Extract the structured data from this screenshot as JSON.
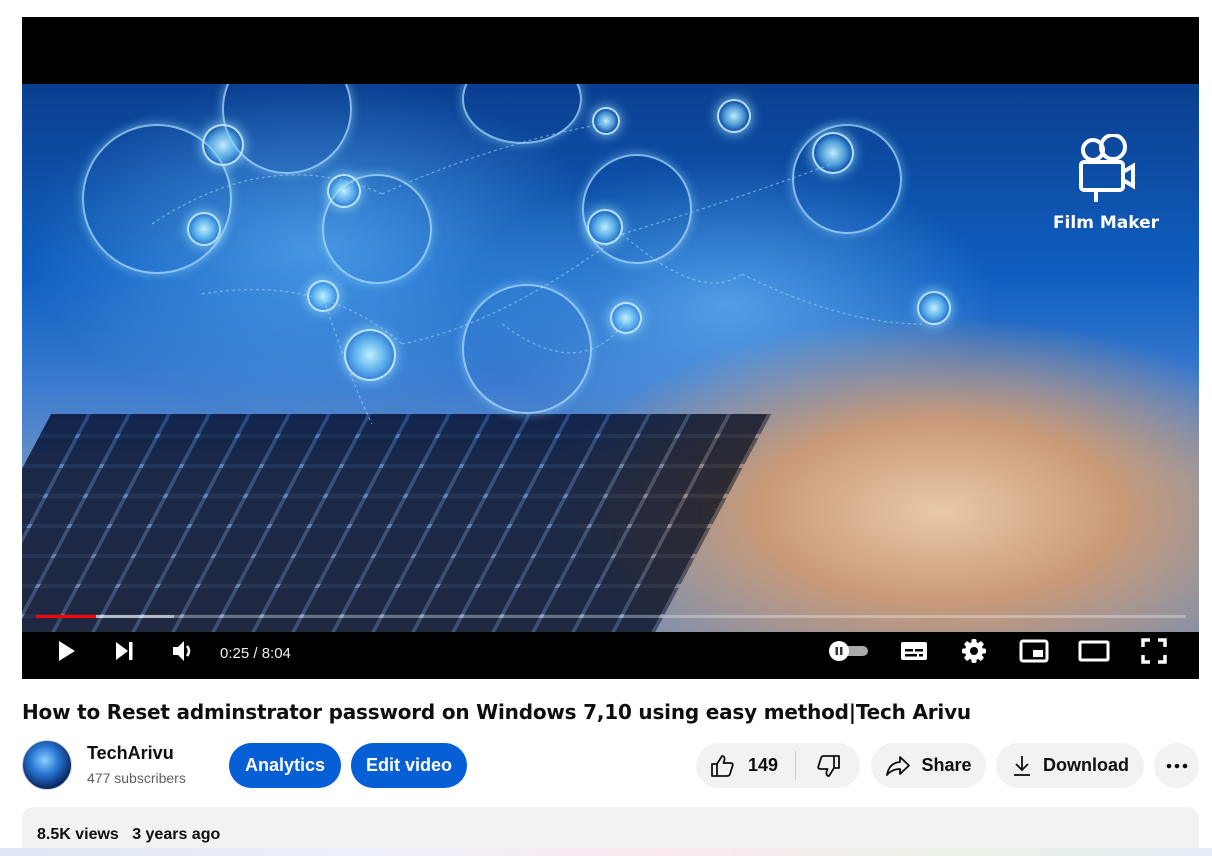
{
  "player": {
    "watermark": "Film Maker",
    "current_time": "0:25",
    "duration": "8:04",
    "time_display": "0:25 / 8:04",
    "progress_fraction": 0.052,
    "buffered_fraction": 0.12,
    "colors": {
      "progress": "#ff0000",
      "background": "#000000"
    },
    "controls": [
      "play-icon",
      "next-icon",
      "volume-icon",
      "autoplay-toggle-icon",
      "subtitles-icon",
      "settings-icon",
      "miniplayer-icon",
      "theater-mode-icon",
      "fullscreen-icon"
    ]
  },
  "video": {
    "title": "How to Reset adminstrator password on Windows 7,10 using easy method|Tech Arivu"
  },
  "channel": {
    "name": "TechArivu",
    "subscribers": "477 subscribers"
  },
  "actions": {
    "analytics_label": "Analytics",
    "edit_video_label": "Edit video",
    "like_count": "149",
    "share_label": "Share",
    "download_label": "Download",
    "accent_color": "#065fd4"
  },
  "description": {
    "views": "8.5K views",
    "age": "3 years ago"
  }
}
